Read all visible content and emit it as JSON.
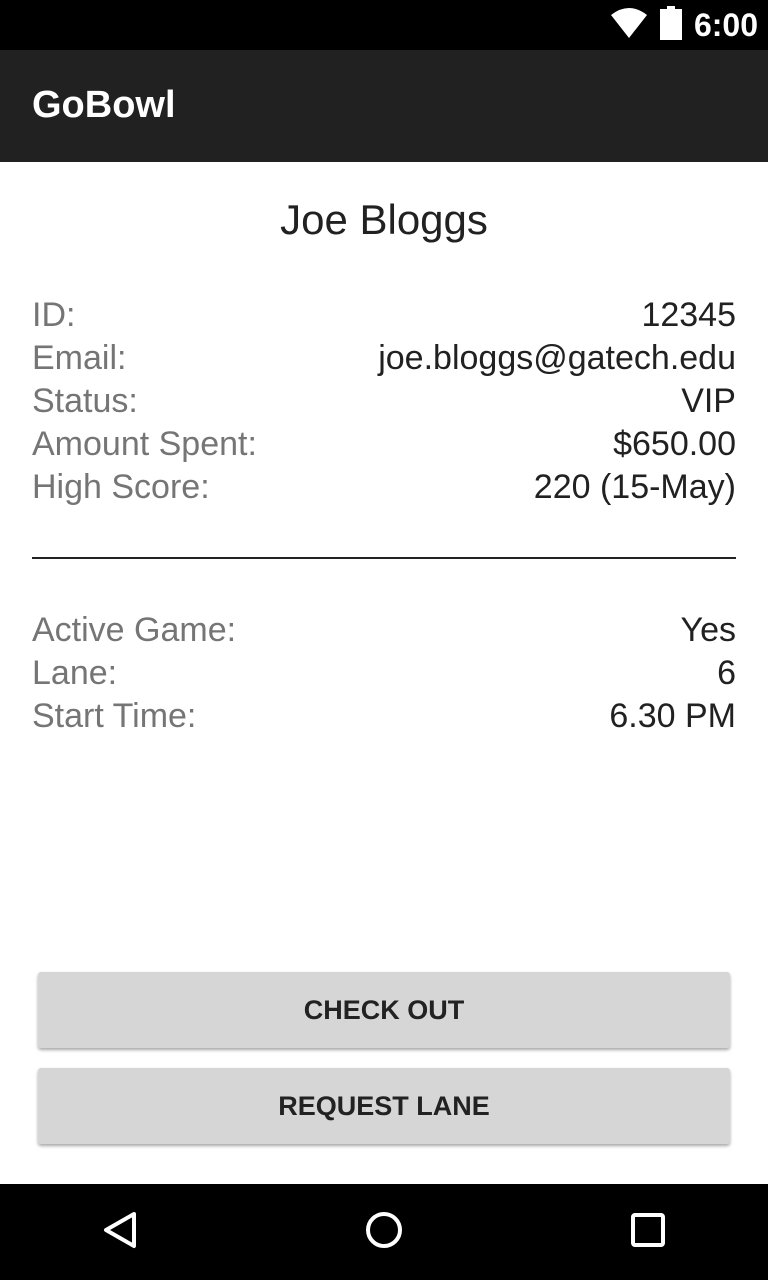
{
  "status_bar": {
    "time": "6:00",
    "icons": [
      "wifi-icon",
      "battery-icon"
    ]
  },
  "app_bar": {
    "title": "GoBowl"
  },
  "profile": {
    "name": "Joe Bloggs",
    "details": [
      {
        "label": "ID:",
        "value": "12345"
      },
      {
        "label": "Email:",
        "value": "joe.bloggs@gatech.edu"
      },
      {
        "label": "Status:",
        "value": "VIP"
      },
      {
        "label": "Amount Spent:",
        "value": "$650.00"
      },
      {
        "label": "High Score:",
        "value": "220 (15-May)"
      }
    ],
    "game": [
      {
        "label": "Active Game:",
        "value": "Yes"
      },
      {
        "label": "Lane:",
        "value": "6"
      },
      {
        "label": "Start Time:",
        "value": "6.30 PM"
      }
    ]
  },
  "actions": {
    "check_out_label": "CHECK OUT",
    "request_lane_label": "REQUEST LANE"
  },
  "nav_bar": {
    "icons": [
      "back-icon",
      "home-icon",
      "recents-icon"
    ]
  },
  "colors": {
    "app_bar": "#212121",
    "button": "#d6d6d6",
    "label_text": "#757575",
    "value_text": "#212121"
  }
}
